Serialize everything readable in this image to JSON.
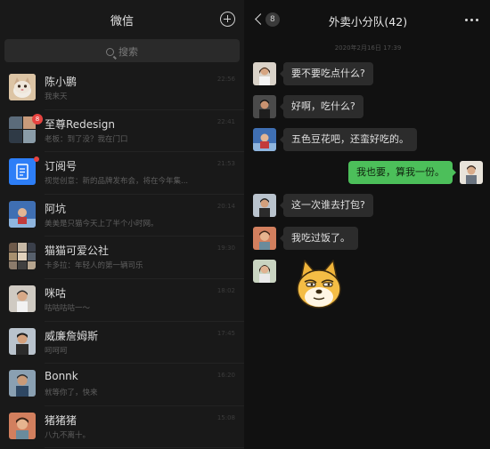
{
  "left_panel": {
    "title": "微信",
    "search_placeholder": "搜索",
    "chats": [
      {
        "name": "陈小鹏",
        "preview": "我来天",
        "time": "22:56"
      },
      {
        "name": "至尊Redesign",
        "preview": "老板：到了没？我在门口",
        "time": "22:41",
        "badge": "8"
      },
      {
        "name": "订阅号",
        "preview": "视觉创意：新的品牌发布会，将在今年集...",
        "time": "21:53"
      },
      {
        "name": "阿坑",
        "preview": "美美是只猫今天上了半个小时网。",
        "time": "20:14"
      },
      {
        "name": "猫猫可爱公社",
        "preview": "卡多拉：年轻人的第一辆司乐",
        "time": "19:30"
      },
      {
        "name": "咪咕",
        "preview": "咕咕咕咕一～",
        "time": "18:02"
      },
      {
        "name": "威廉詹姆斯",
        "preview": "呵呵呵",
        "time": "17:45"
      },
      {
        "name": "Bonnk",
        "preview": "就等你了，快来",
        "time": "16:20"
      },
      {
        "name": "猪猪猪",
        "preview": "八九不离十。",
        "time": "15:08"
      }
    ]
  },
  "right_panel": {
    "back_count": "8",
    "chat_title": "外卖小分队(42)",
    "timestamp": "2020年2月16日 17:39",
    "messages": [
      {
        "side": "in",
        "text": "要不要吃点什么?"
      },
      {
        "side": "in",
        "text": "好啊，吃什么?"
      },
      {
        "side": "in",
        "text": "五色豆花吧，还蛮好吃的。"
      },
      {
        "side": "out",
        "text": "我也要，算我一份。"
      },
      {
        "side": "in",
        "text": "这一次谁去打包?"
      },
      {
        "side": "in",
        "text": "我吃过饭了。"
      }
    ]
  },
  "colors": {
    "panel_bg": "#191919",
    "chat_bg": "#111111",
    "bubble_in": "#2c2c2c",
    "bubble_out": "#4cbf5a",
    "badge": "#e64340",
    "subscription_icon": "#2d7ef7"
  },
  "icons": [
    "plus-circle-icon",
    "search-icon",
    "back-chevron-icon",
    "more-icon",
    "doge-sticker-icon"
  ]
}
